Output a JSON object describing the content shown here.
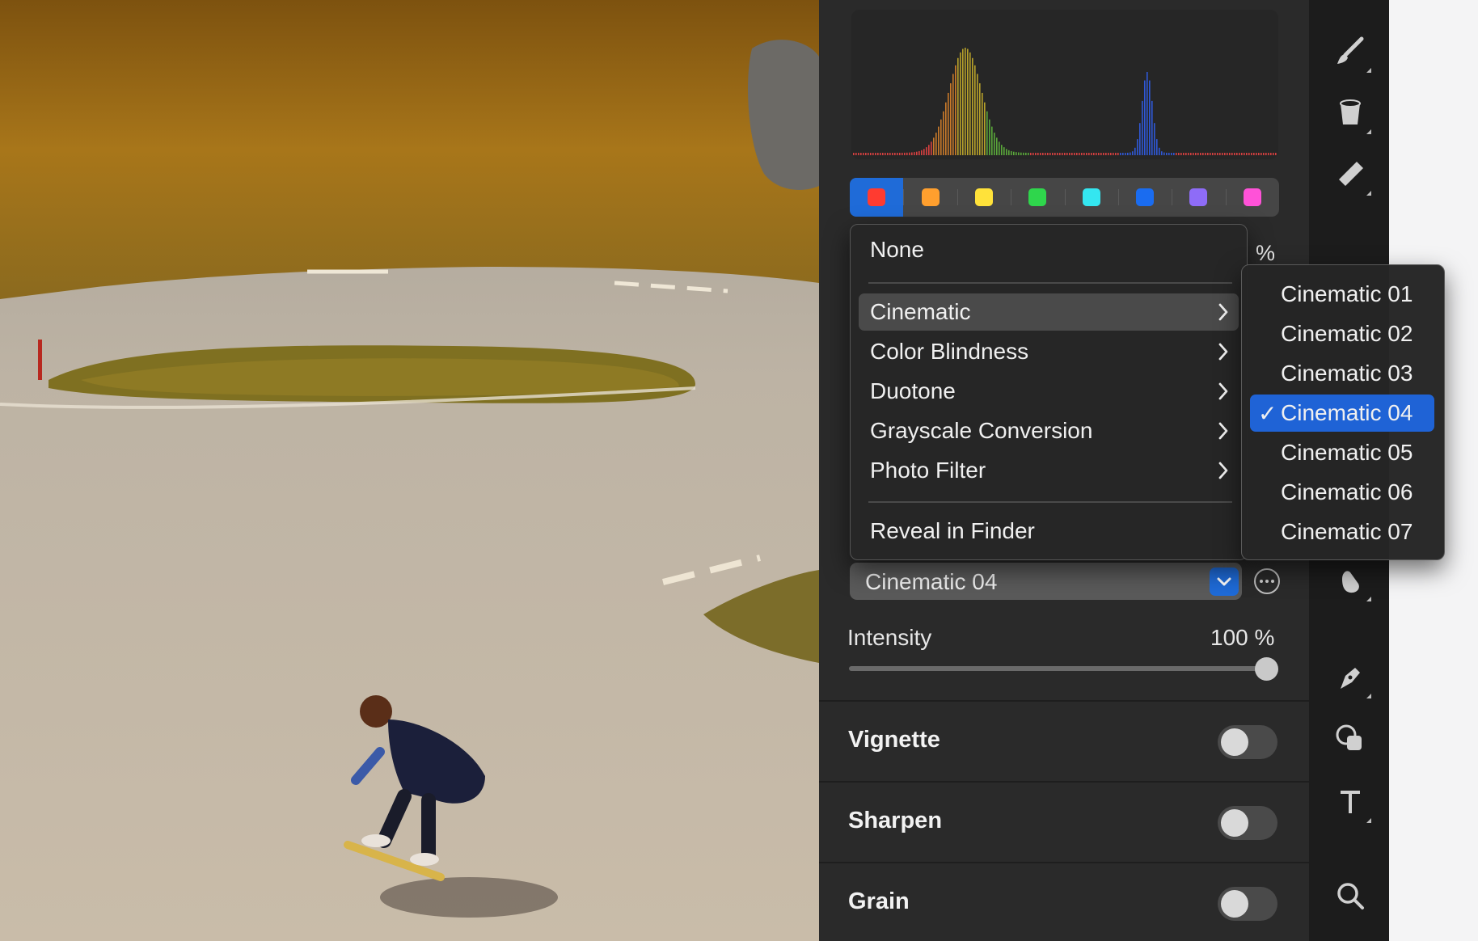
{
  "photo": {
    "description_icon": "photo-canvas"
  },
  "swatches": {
    "colors": [
      "#ff3b30",
      "#ff9f2e",
      "#ffe23a",
      "#2fd64c",
      "#34e6f0",
      "#1a6cf0",
      "#8e6cf7",
      "#ff52d8"
    ],
    "active_index": 0
  },
  "top_percent": "%",
  "menu": {
    "items": [
      {
        "label": "None",
        "submenu": false
      },
      {
        "label": "Cinematic",
        "submenu": true,
        "highlighted": true
      },
      {
        "label": "Color Blindness",
        "submenu": true
      },
      {
        "label": "Duotone",
        "submenu": true
      },
      {
        "label": "Grayscale Conversion",
        "submenu": true
      },
      {
        "label": "Photo Filter",
        "submenu": true
      },
      {
        "label": "Reveal in Finder",
        "submenu": false
      }
    ],
    "arrow_glyph": "›"
  },
  "submenu": {
    "items": [
      "Cinematic 01",
      "Cinematic 02",
      "Cinematic 03",
      "Cinematic 04",
      "Cinematic 05",
      "Cinematic 06",
      "Cinematic 07"
    ],
    "selected": "Cinematic 04",
    "check_glyph": "✓"
  },
  "lut": {
    "value": "Cinematic 04"
  },
  "intensity": {
    "label": "Intensity",
    "value": "100 %",
    "level": 1.0
  },
  "sections": [
    {
      "label": "Vignette",
      "on": false
    },
    {
      "label": "Sharpen",
      "on": false
    },
    {
      "label": "Grain",
      "on": false
    }
  ],
  "toolbar": [
    "brush-icon",
    "paint-bucket-icon",
    "eraser-icon",
    "stamp-icon",
    "smudge-icon",
    "pen-icon",
    "shapes-icon",
    "text-icon",
    "search-icon"
  ],
  "accent": "#1f6bd8"
}
